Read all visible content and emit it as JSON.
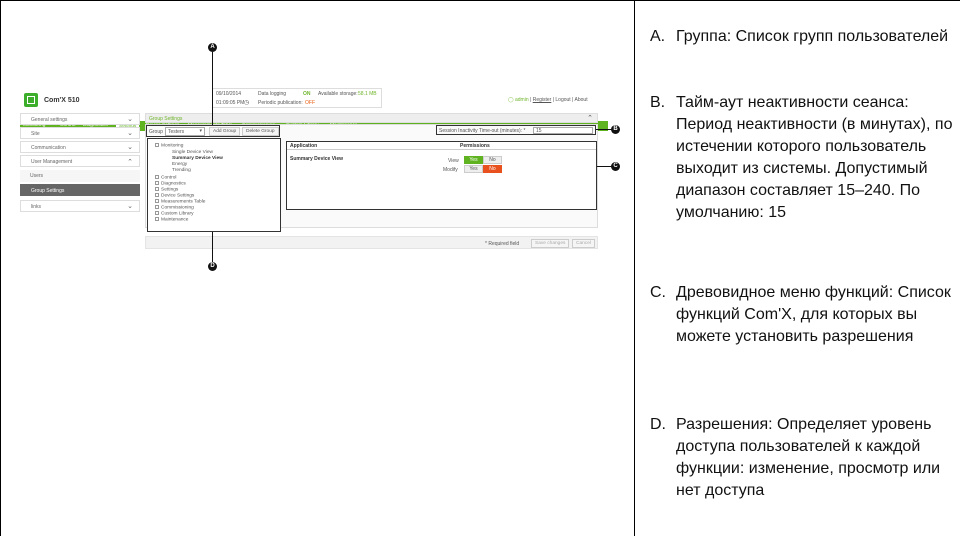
{
  "app": {
    "name": "Com'X 510",
    "date": "09/10/2014",
    "time": "01:09:05 PM"
  },
  "status": {
    "data_logging_label": "Data logging",
    "data_logging_value": "ON",
    "storage_label": "Available storage:",
    "storage_value": "58.1 MB",
    "publication_label": "Periodic publication:",
    "publication_value": "OFF"
  },
  "user_links": [
    "admin",
    "Register",
    "Logout",
    "About"
  ],
  "nav_tabs": [
    "Monitoring",
    "Control",
    "Diagnostics",
    "Settings",
    "Device Settings",
    "Measurements Table",
    "Commissioning",
    "Custom Library",
    "Maintenance"
  ],
  "sidebar": [
    "General settings",
    "Site",
    "Communication",
    "User Management",
    "Users",
    "Group Settings",
    "links"
  ],
  "main": {
    "section_title": "Group Settings",
    "group_label": "Group",
    "group_value": "Testers",
    "add_group": "Add Group",
    "delete_group": "Delete Group",
    "timeout_label": "Session Inactivity Time-out (minutes): *",
    "timeout_value": "15",
    "tree": [
      "Monitoring",
      "Single Device View",
      "Summary Device View",
      "Energy",
      "Trending",
      "Control",
      "Diagnostics",
      "Settings",
      "Device Settings",
      "Measurements Table",
      "Commissioning",
      "Custom Library",
      "Maintenance"
    ],
    "perm_col_app": "Application",
    "perm_col_perm": "Permissions",
    "perm_row": "Summary Device View",
    "perm_view": "View",
    "perm_modify": "Modify",
    "yes": "Yes",
    "no": "No",
    "required": "* Required field",
    "save": "Save changes",
    "cancel": "Cancel"
  },
  "callouts": [
    "A",
    "B",
    "C",
    "D"
  ],
  "legend": [
    {
      "letter": "A.",
      "text": "Группа: Список групп пользователей"
    },
    {
      "letter": "B.",
      "text": "Тайм-аут неактивности сеанса: Период неактивности (в минутах), по истечении которого пользователь выходит из системы. Допустимый диапазон составляет 15–240. По умолчанию: 15"
    },
    {
      "letter": "C.",
      "text": "Древовидное меню функций: Список функций Com'X, для которых вы можете установить разрешения"
    },
    {
      "letter": "D.",
      "text": "Разрешения: Определяет уровень доступа пользователей к каждой функции: изменение, просмотр или нет доступа"
    }
  ]
}
